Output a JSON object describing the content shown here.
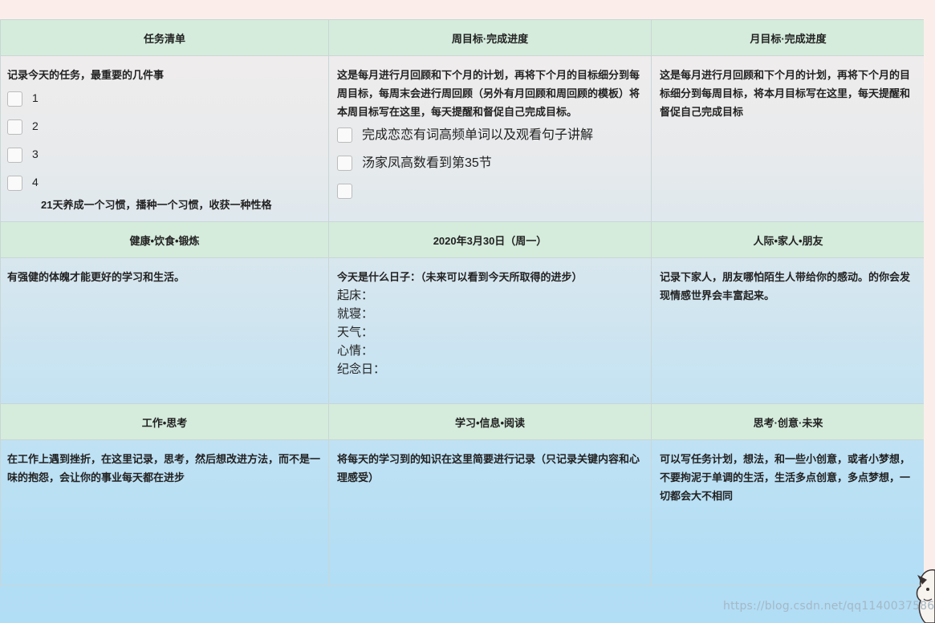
{
  "headers": {
    "row1": [
      "任务清单",
      "周目标·完成进度",
      "月目标·完成进度"
    ],
    "row2": [
      "健康•饮食•锻炼",
      "2020年3月30日（周一）",
      "人际•家人•朋友"
    ],
    "row3": [
      "工作•思考",
      "学习•信息•阅读",
      "思考·创意·未来"
    ]
  },
  "tasks": {
    "intro": "记录今天的任务，最重要的几件事",
    "items": [
      "1",
      "2",
      "3",
      "4"
    ],
    "motto": "21天养成一个习惯，播种一个习惯，收获一种性格"
  },
  "weekly": {
    "intro": "这是每月进行月回顾和下个月的计划，再将下个月的目标细分到每周目标，每周末会进行周回顾（另外有月回顾和周回顾的模板）将本周目标写在这里，每天提醒和督促自己完成目标。",
    "items": [
      "完成恋恋有词高频单词以及观看句子讲解",
      "汤家凤高数看到第35节",
      ""
    ]
  },
  "monthly": {
    "intro": "这是每月进行月回顾和下个月的计划，再将下个月的目标细分到每周目标，将本月目标写在这里，每天提醒和督促自己完成目标"
  },
  "health": {
    "text": "有强健的体魄才能更好的学习和生活。"
  },
  "today": {
    "intro": "今天是什么日子：（未来可以看到今天所取得的进步）",
    "fields": [
      "起床：",
      "就寝：",
      "天气：",
      "心情：",
      "纪念日："
    ]
  },
  "social": {
    "text": "记录下家人，朋友哪怕陌生人带给你的感动。的你会发现情感世界会丰富起来。"
  },
  "work": {
    "text": "在工作上遇到挫折，在这里记录，思考，然后想改进方法，而不是一味的抱怨，会让你的事业每天都在进步"
  },
  "study": {
    "text": "将每天的学习到的知识在这里简要进行记录（只记录关键内容和心理感受）"
  },
  "ideas": {
    "text": "可以写任务计划，想法，和一些小创意，或者小梦想，不要拘泥于单调的生活，生活多点创意，多点梦想，一切都会大不相同"
  },
  "watermark": "https://blog.csdn.net/qq1140037586",
  "colors": {
    "header_bg": "#d5ecdc",
    "border": "#c9d6d6",
    "bg_bottom": "#b1ddf5"
  }
}
